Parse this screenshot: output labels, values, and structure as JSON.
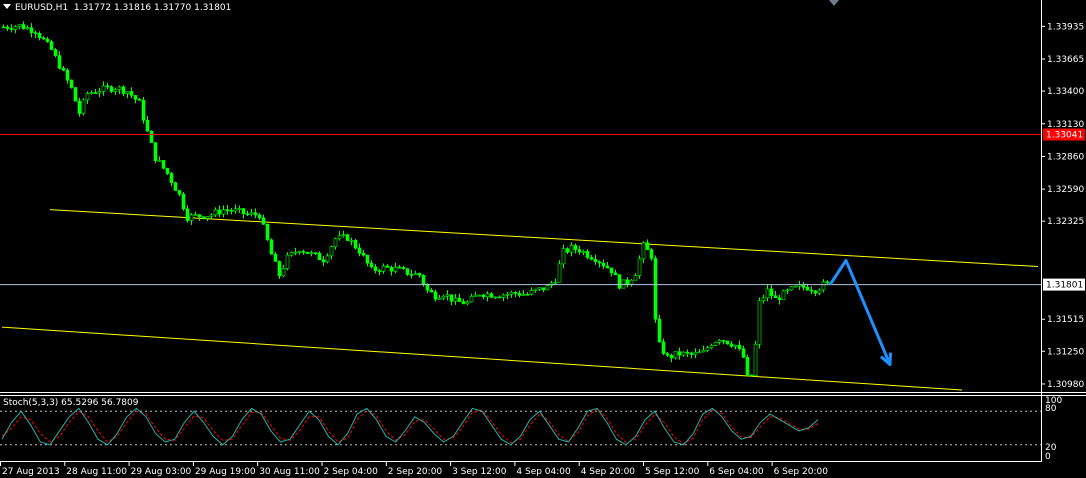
{
  "header": {
    "symbol": "EURUSD,H1",
    "ohlc": "1.31772 1.31816 1.31770 1.31801"
  },
  "stochastic": {
    "label": "Stoch(5,3,3) 65.5296 56.7809",
    "levels": [
      "100",
      "80",
      "20",
      "0"
    ]
  },
  "colors": {
    "background": "#000000",
    "candle": "#00ff00",
    "trendline": "#ffff00",
    "resistance": "#ff0000",
    "bid_line": "#b0c4de",
    "arrow": "#1e90ff",
    "stoch_main": "#20b2aa",
    "stoch_signal": "#ff0000",
    "axis": "#ffffff"
  },
  "chart_data": {
    "type": "candlestick",
    "yticks": [
      "1.33935",
      "1.33665",
      "1.33400",
      "1.33130",
      "1.32860",
      "1.32590",
      "1.32325",
      "1.31515",
      "1.31250",
      "1.30980"
    ],
    "price_labels": {
      "resistance": "1.33041",
      "current": "1.31801"
    },
    "xticks": [
      "27 Aug 2013",
      "28 Aug 11:00",
      "29 Aug 03:00",
      "29 Aug 19:00",
      "30 Aug 11:00",
      "2 Sep 04:00",
      "2 Sep 20:00",
      "3 Sep 12:00",
      "4 Sep 04:00",
      "4 Sep 20:00",
      "5 Sep 12:00",
      "6 Sep 04:00",
      "6 Sep 20:00"
    ],
    "ylim": [
      1.3093,
      1.3407
    ],
    "close_path": [
      {
        "t": 0,
        "p": 1.3393
      },
      {
        "t": 4,
        "p": 1.3394
      },
      {
        "t": 8,
        "p": 1.339
      },
      {
        "t": 12,
        "p": 1.3374
      },
      {
        "t": 15,
        "p": 1.3355
      },
      {
        "t": 17,
        "p": 1.3342
      },
      {
        "t": 19,
        "p": 1.3322
      },
      {
        "t": 21,
        "p": 1.3338
      },
      {
        "t": 24,
        "p": 1.3341
      },
      {
        "t": 28,
        "p": 1.3343
      },
      {
        "t": 31,
        "p": 1.334
      },
      {
        "t": 34,
        "p": 1.333
      },
      {
        "t": 36,
        "p": 1.3306
      },
      {
        "t": 38,
        "p": 1.3285
      },
      {
        "t": 41,
        "p": 1.3272
      },
      {
        "t": 44,
        "p": 1.3254
      },
      {
        "t": 46,
        "p": 1.3236
      },
      {
        "t": 49,
        "p": 1.3237
      },
      {
        "t": 52,
        "p": 1.3238
      },
      {
        "t": 55,
        "p": 1.3242
      },
      {
        "t": 58,
        "p": 1.3241
      },
      {
        "t": 61,
        "p": 1.3238
      },
      {
        "t": 64,
        "p": 1.3238
      },
      {
        "t": 67,
        "p": 1.3205
      },
      {
        "t": 69,
        "p": 1.3188
      },
      {
        "t": 71,
        "p": 1.3202
      },
      {
        "t": 74,
        "p": 1.321
      },
      {
        "t": 77,
        "p": 1.3205
      },
      {
        "t": 80,
        "p": 1.3201
      },
      {
        "t": 83,
        "p": 1.3218
      },
      {
        "t": 86,
        "p": 1.3219
      },
      {
        "t": 89,
        "p": 1.3208
      },
      {
        "t": 92,
        "p": 1.3192
      },
      {
        "t": 95,
        "p": 1.3194
      },
      {
        "t": 98,
        "p": 1.3193
      },
      {
        "t": 101,
        "p": 1.319
      },
      {
        "t": 104,
        "p": 1.3188
      },
      {
        "t": 106,
        "p": 1.3175
      },
      {
        "t": 108,
        "p": 1.3171
      },
      {
        "t": 110,
        "p": 1.3173
      },
      {
        "t": 113,
        "p": 1.3166
      },
      {
        "t": 116,
        "p": 1.3165
      },
      {
        "t": 119,
        "p": 1.3173
      },
      {
        "t": 122,
        "p": 1.3172
      },
      {
        "t": 125,
        "p": 1.3172
      },
      {
        "t": 128,
        "p": 1.3173
      },
      {
        "t": 131,
        "p": 1.3172
      },
      {
        "t": 133,
        "p": 1.3175
      },
      {
        "t": 136,
        "p": 1.3178
      },
      {
        "t": 138,
        "p": 1.3185
      },
      {
        "t": 140,
        "p": 1.3207
      },
      {
        "t": 142,
        "p": 1.321
      },
      {
        "t": 144,
        "p": 1.3209
      },
      {
        "t": 146,
        "p": 1.3205
      },
      {
        "t": 148,
        "p": 1.3202
      },
      {
        "t": 150,
        "p": 1.3197
      },
      {
        "t": 152,
        "p": 1.3192
      },
      {
        "t": 154,
        "p": 1.318
      },
      {
        "t": 156,
        "p": 1.3182
      },
      {
        "t": 158,
        "p": 1.319
      },
      {
        "t": 160,
        "p": 1.3212
      },
      {
        "t": 162,
        "p": 1.3204
      },
      {
        "t": 163,
        "p": 1.315
      },
      {
        "t": 164,
        "p": 1.313
      },
      {
        "t": 166,
        "p": 1.312
      },
      {
        "t": 169,
        "p": 1.3123
      },
      {
        "t": 172,
        "p": 1.3122
      },
      {
        "t": 175,
        "p": 1.3124
      },
      {
        "t": 177,
        "p": 1.3132
      },
      {
        "t": 179,
        "p": 1.3136
      },
      {
        "t": 181,
        "p": 1.3133
      },
      {
        "t": 183,
        "p": 1.313
      },
      {
        "t": 185,
        "p": 1.312
      },
      {
        "t": 186,
        "p": 1.3103
      },
      {
        "t": 187,
        "p": 1.3105
      },
      {
        "t": 188,
        "p": 1.313
      },
      {
        "t": 189,
        "p": 1.3165
      },
      {
        "t": 191,
        "p": 1.3175
      },
      {
        "t": 193,
        "p": 1.3168
      },
      {
        "t": 195,
        "p": 1.3172
      },
      {
        "t": 197,
        "p": 1.3176
      },
      {
        "t": 199,
        "p": 1.3178
      },
      {
        "t": 201,
        "p": 1.3178
      },
      {
        "t": 203,
        "p": 1.3176
      },
      {
        "t": 205,
        "p": 1.318
      },
      {
        "t": 206,
        "p": 1.318
      }
    ],
    "trendlines": [
      {
        "t1": 12,
        "p1": 1.3242,
        "t2": 259,
        "p2": 1.3195
      },
      {
        "t1": 0,
        "p1": 1.3145,
        "t2": 240,
        "p2": 1.3093
      }
    ],
    "forecast_arrow": [
      {
        "t": 207,
        "p": 1.318
      },
      {
        "t": 211,
        "p": 1.32
      },
      {
        "t": 222,
        "p": 1.3114
      }
    ],
    "stoch_main": [
      30,
      60,
      80,
      55,
      25,
      20,
      45,
      70,
      85,
      60,
      30,
      20,
      40,
      70,
      85,
      70,
      40,
      25,
      30,
      60,
      80,
      60,
      35,
      20,
      35,
      65,
      85,
      75,
      45,
      25,
      30,
      55,
      80,
      65,
      35,
      20,
      40,
      75,
      85,
      65,
      35,
      25,
      45,
      70,
      60,
      40,
      25,
      35,
      60,
      85,
      80,
      55,
      30,
      20,
      35,
      65,
      80,
      55,
      30,
      25,
      50,
      80,
      85,
      60,
      30,
      20,
      35,
      65,
      80,
      50,
      25,
      20,
      40,
      75,
      85,
      70,
      45,
      30,
      35,
      60,
      75,
      65,
      55,
      45,
      50,
      65
    ],
    "stoch_signal": [
      35,
      50,
      70,
      65,
      40,
      25,
      35,
      60,
      80,
      70,
      45,
      25,
      35,
      60,
      80,
      75,
      50,
      30,
      28,
      50,
      72,
      68,
      45,
      28,
      30,
      55,
      78,
      78,
      55,
      32,
      28,
      45,
      70,
      70,
      45,
      25,
      32,
      65,
      82,
      72,
      45,
      28,
      38,
      62,
      65,
      48,
      30,
      32,
      52,
      78,
      82,
      62,
      38,
      24,
      30,
      55,
      75,
      62,
      38,
      26,
      42,
      72,
      84,
      68,
      40,
      24,
      30,
      55,
      75,
      60,
      34,
      22,
      32,
      65,
      82,
      76,
      52,
      34,
      33,
      52,
      70,
      68,
      58,
      48,
      48,
      58
    ]
  }
}
